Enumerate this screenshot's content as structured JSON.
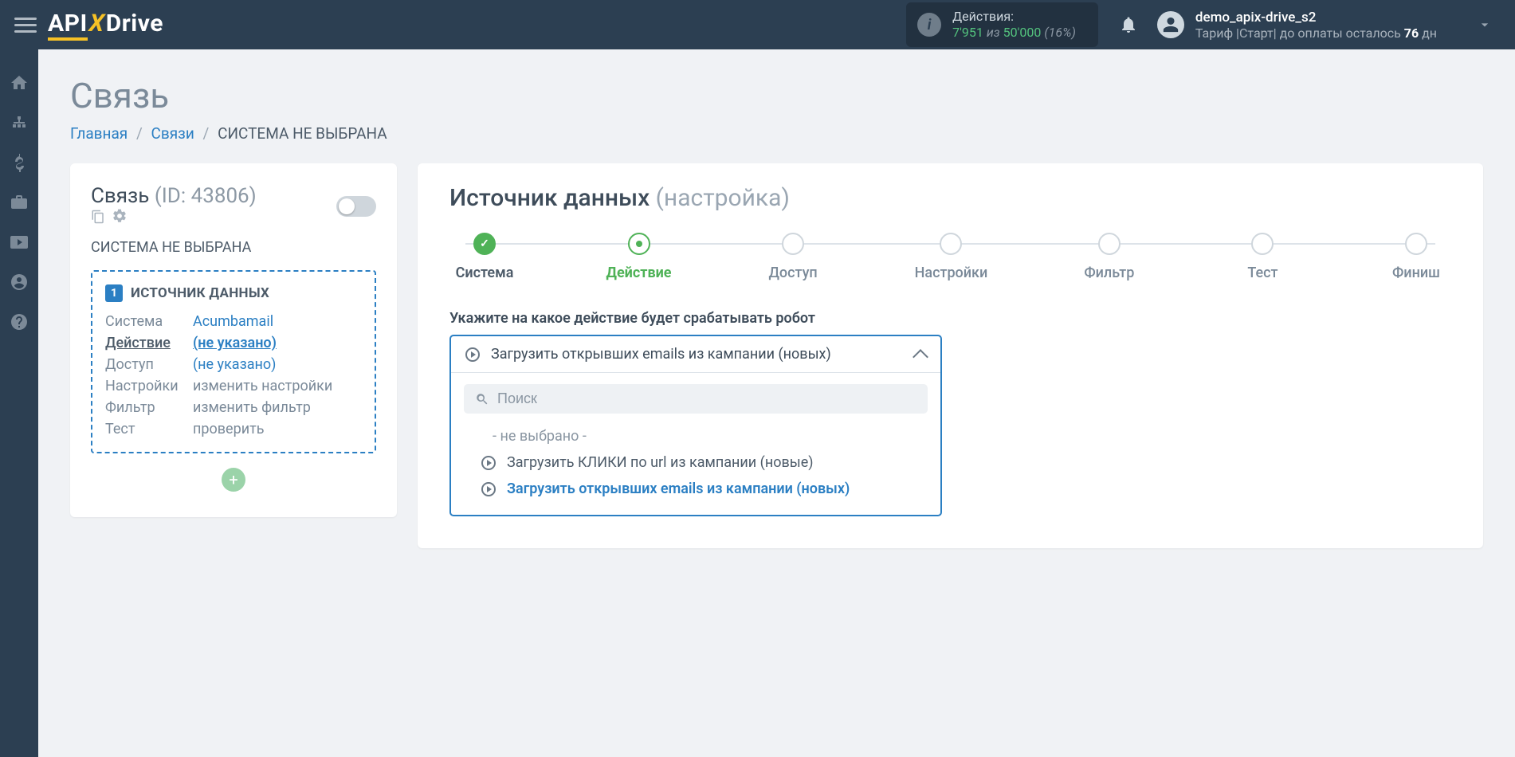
{
  "header": {
    "actions_label": "Действия:",
    "actions_count": "7'951",
    "actions_iz": "из",
    "actions_limit": "50'000",
    "actions_pct": "(16%)",
    "username": "demo_apix-drive_s2",
    "tariff_prefix": "Тариф |Старт| до оплаты осталось ",
    "tariff_days": "76",
    "tariff_suffix": " дн"
  },
  "page": {
    "title": "Связь",
    "crumb_home": "Главная",
    "crumb_links": "Связи",
    "crumb_current": "СИСТЕМА НЕ ВЫБРАНА"
  },
  "leftcard": {
    "title_main": "Связь ",
    "title_id": "(ID: 43806)",
    "subtitle": "СИСТЕМА НЕ ВЫБРАНА",
    "src_badge": "1",
    "src_title": "ИСТОЧНИК ДАННЫХ",
    "rows": {
      "system_k": "Система",
      "system_v": "Acumbamail",
      "action_k": "Действие",
      "action_v": "(не указано)",
      "access_k": "Доступ",
      "access_v": "(не указано)",
      "settings_k": "Настройки",
      "settings_v": "изменить настройки",
      "filter_k": "Фильтр",
      "filter_v": "изменить фильтр",
      "test_k": "Тест",
      "test_v": "проверить"
    }
  },
  "rightcard": {
    "title_main": "Источник данных ",
    "title_sub": "(настройка)",
    "steps": {
      "s1": "Система",
      "s2": "Действие",
      "s3": "Доступ",
      "s4": "Настройки",
      "s5": "Фильтр",
      "s6": "Тест",
      "s7": "Финиш"
    },
    "prompt": "Укажите на какое действие будет срабатывать робот",
    "selected": "Загрузить открывших emails из кампании (новых)",
    "search_placeholder": "Поиск",
    "options": {
      "none": "- не выбрано -",
      "o1": "Загрузить КЛИКИ по url из кампании (новые)",
      "o2": "Загрузить открывших emails из кампании (новых)"
    }
  }
}
